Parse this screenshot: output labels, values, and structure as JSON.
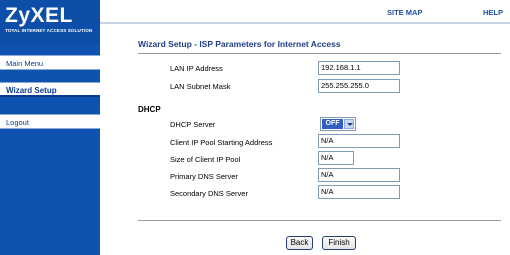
{
  "brand": {
    "logo": "ZyXEL",
    "tagline": "TOTAL INTERNET ACCESS SOLUTION"
  },
  "topnav": {
    "site_map": "SITE MAP",
    "help": "HELP"
  },
  "sidebar": {
    "items": [
      {
        "label": "Main Menu"
      },
      {
        "label": "Wizard Setup"
      },
      {
        "label": "Logout"
      }
    ]
  },
  "page": {
    "title": "Wizard Setup - ISP Parameters for Internet Access"
  },
  "lan": {
    "ip_label": "LAN IP Address",
    "ip_value": "192.168.1.1",
    "mask_label": "LAN Subnet Mask",
    "mask_value": "255.255.255.0"
  },
  "dhcp": {
    "section_label": "DHCP",
    "server_label": "DHCP Server",
    "server_value": "OFF",
    "pool_start_label": "Client IP Pool Starting Address",
    "pool_start_value": "N/A",
    "pool_size_label": "Size of Client IP Pool",
    "pool_size_value": "N/A",
    "primary_dns_label": "Primary DNS Server",
    "primary_dns_value": "N/A",
    "secondary_dns_label": "Secondary DNS Server",
    "secondary_dns_value": "N/A"
  },
  "actions": {
    "back": "Back",
    "finish": "Finish"
  },
  "colors": {
    "sidebar": "#0f53b1",
    "title": "#1f3f86",
    "link": "#1f4fa3"
  }
}
